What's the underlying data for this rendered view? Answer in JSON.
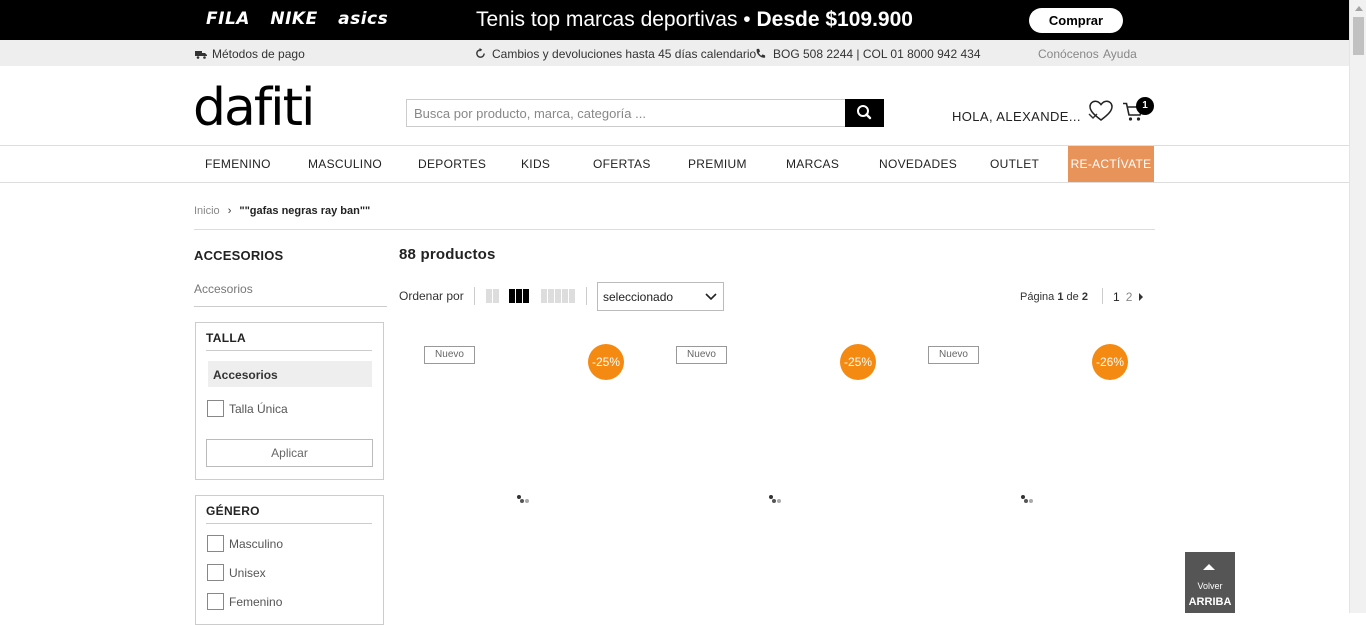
{
  "promo": {
    "brands": [
      "FILA",
      "NIKE",
      "asics"
    ],
    "text": "Tenis top marcas deportivas •",
    "price_text": "Desde $109.900",
    "button": "Comprar"
  },
  "infobar": {
    "payment": "Métodos de pago",
    "returns": "Cambios y devoluciones hasta 45 días calendario",
    "phone": "BOG 508 2244 | COL 01 8000 942 434",
    "about": "Conócenos",
    "help": "Ayuda"
  },
  "header": {
    "logo": "dafiti",
    "search_placeholder": "Busca por producto, marca, categoría ...",
    "user_greeting": "HOLA, ALEXANDE...",
    "cart_count": "1"
  },
  "nav": {
    "items": [
      "FEMENINO",
      "MASCULINO",
      "DEPORTES",
      "KIDS",
      "OFERTAS",
      "PREMIUM",
      "MARCAS",
      "NOVEDADES",
      "OUTLET"
    ],
    "highlight": "RE-ACTÍVATE"
  },
  "breadcrumb": {
    "home": "Inicio",
    "separator": "›",
    "query": "\"\"gafas negras ray ban\"\""
  },
  "sidebar": {
    "title": "ACCESORIOS",
    "subcategory": "Accesorios",
    "size_filter": {
      "title": "TALLA",
      "group": "Accesorios",
      "options": [
        "Talla Única"
      ],
      "apply": "Aplicar"
    },
    "gender_filter": {
      "title": "GÉNERO",
      "options": [
        "Masculino",
        "Unisex",
        "Femenino"
      ]
    }
  },
  "results": {
    "count_label": "88 productos",
    "sort_label": "Ordenar por",
    "sort_value": "seleccionado",
    "page_prefix": "Página",
    "page_current": "1",
    "page_of": "de",
    "page_total": "2",
    "pages": [
      "1",
      "2"
    ]
  },
  "products": [
    {
      "badge": "Nuevo",
      "discount": "-25%"
    },
    {
      "badge": "Nuevo",
      "discount": "-25%"
    },
    {
      "badge": "Nuevo",
      "discount": "-26%"
    }
  ],
  "back_to_top": {
    "line1": "Volver",
    "line2": "ARRIBA"
  },
  "colors": {
    "accent_orange": "#f58a12",
    "reactivate_bg": "#e8935a",
    "promo_bg": "#000000"
  }
}
